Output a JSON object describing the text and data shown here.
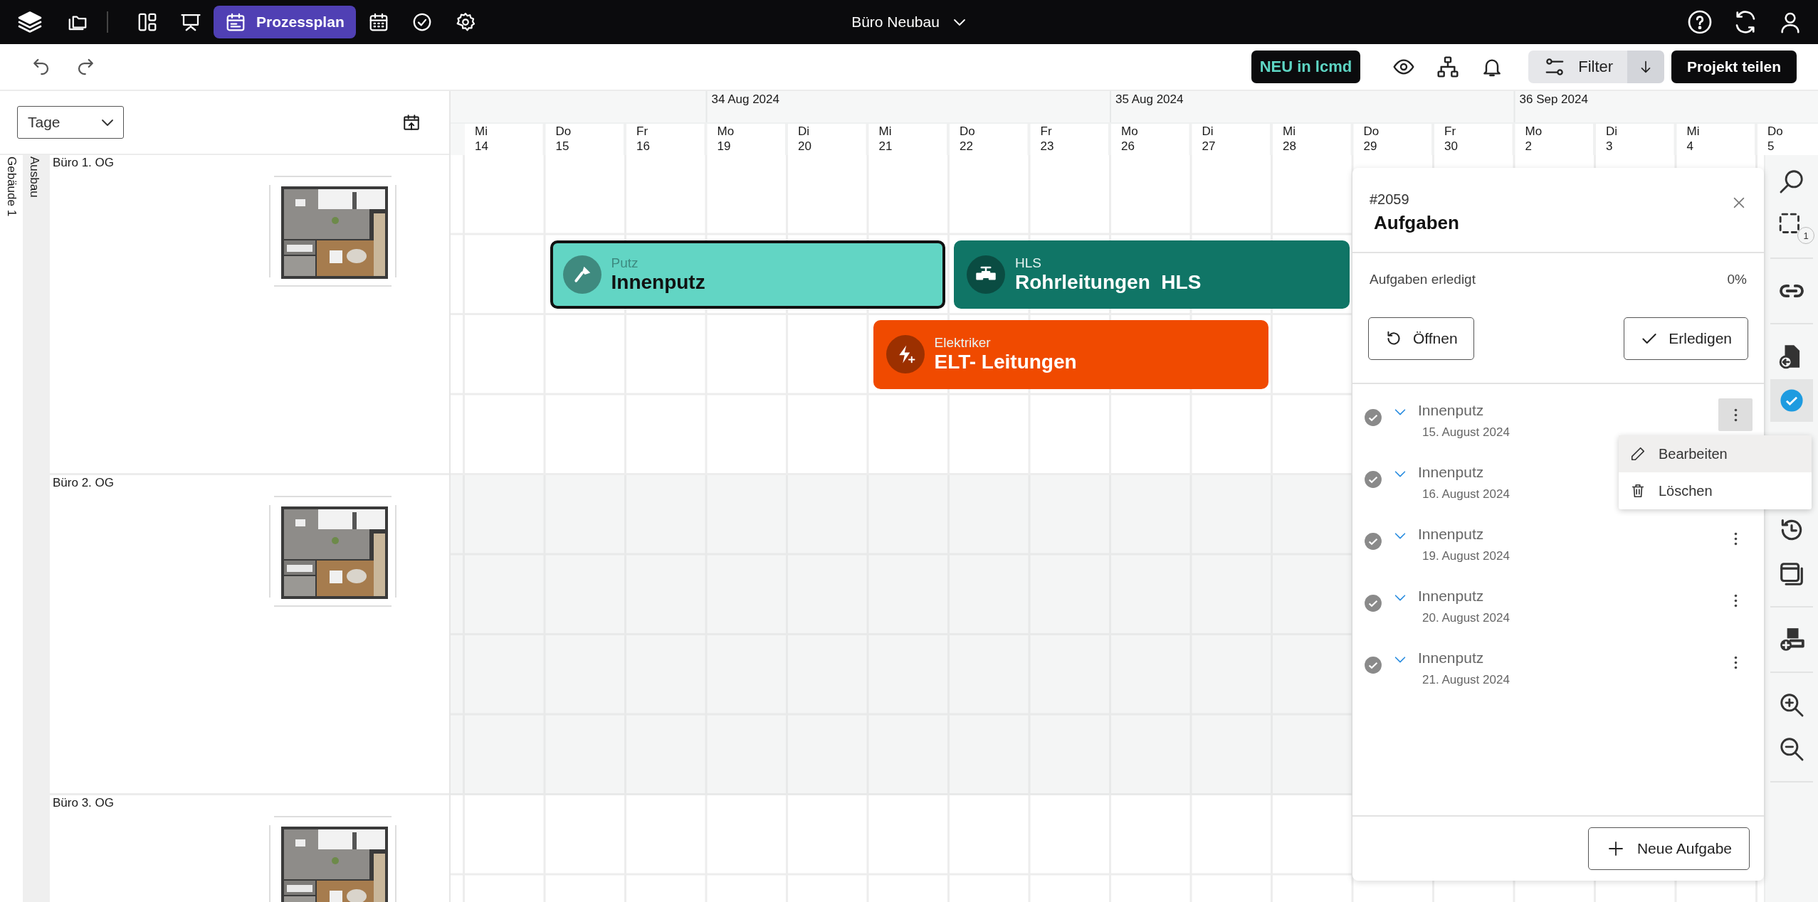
{
  "top_bar": {
    "nav": [
      {
        "kind": "icon",
        "selected": false
      },
      {
        "kind": "icon",
        "selected": false
      },
      {
        "kind": "label",
        "label": "Prozessplan",
        "selected": true
      },
      {
        "kind": "icon",
        "selected": false
      },
      {
        "kind": "icon",
        "selected": false
      },
      {
        "kind": "icon",
        "selected": false
      }
    ],
    "project": "Büro Neubau"
  },
  "toolbar": {
    "news_badge": "NEU in lcmd",
    "filter_button": "Filter",
    "share_button": "Projekt teilen"
  },
  "sidebar": {
    "view_select": {
      "value": "Tage"
    },
    "building": "Gebäude 1",
    "trade_group": "Ausbau",
    "floors": [
      {
        "name": "Büro 1. OG"
      },
      {
        "name": "Büro 2. OG"
      },
      {
        "name": "Büro 3. OG"
      }
    ]
  },
  "timeline": {
    "weeks": [
      "34 Aug 2024",
      "35 Aug 2024",
      "36 Sep 2024"
    ],
    "days": [
      {
        "weekday": "Mi",
        "day": "14"
      },
      {
        "weekday": "Do",
        "day": "15"
      },
      {
        "weekday": "Fr",
        "day": "16"
      },
      {
        "weekday": "Mo",
        "day": "19"
      },
      {
        "weekday": "Di",
        "day": "20"
      },
      {
        "weekday": "Mi",
        "day": "21"
      },
      {
        "weekday": "Do",
        "day": "22"
      },
      {
        "weekday": "Fr",
        "day": "23"
      },
      {
        "weekday": "Mo",
        "day": "26"
      },
      {
        "weekday": "Di",
        "day": "27"
      },
      {
        "weekday": "Mi",
        "day": "28"
      },
      {
        "weekday": "Do",
        "day": "29"
      },
      {
        "weekday": "Fr",
        "day": "30"
      },
      {
        "weekday": "Mo",
        "day": "2"
      },
      {
        "weekday": "Di",
        "day": "3"
      },
      {
        "weekday": "Mi",
        "day": "4"
      },
      {
        "weekday": "Do",
        "day": "5"
      }
    ],
    "tasks": [
      {
        "trade": "Putz",
        "title": "Innenputz",
        "color": "#62d5c4",
        "selected": true
      },
      {
        "trade": "HLS",
        "title": "Rohrleitungen  HLS",
        "color": "#107566",
        "selected": false
      },
      {
        "trade": "Elektriker",
        "title": "ELT- Leitungen",
        "color": "#f04a00",
        "selected": false
      }
    ]
  },
  "task_panel": {
    "number": "#2059",
    "title": "Aufgaben",
    "progress_label": "Aufgaben erledigt",
    "progress_value": "0%",
    "buttons": [
      "Öffnen",
      "Erledigen"
    ],
    "items": [
      {
        "title": "Innenputz",
        "date": "15. August 2024",
        "menu_open": true
      },
      {
        "title": "Innenputz",
        "date": "16. August 2024",
        "menu_open": false
      },
      {
        "title": "Innenputz",
        "date": "19. August 2024",
        "menu_open": false
      },
      {
        "title": "Innenputz",
        "date": "20. August 2024",
        "menu_open": false
      },
      {
        "title": "Innenputz",
        "date": "21. August 2024",
        "menu_open": false
      }
    ],
    "new_button": "Neue Aufgabe"
  },
  "context_menu": [
    {
      "label": "Bearbeiten",
      "highlighted": true
    },
    {
      "label": "Löschen",
      "highlighted": false
    }
  ],
  "tool_rail": {
    "selection_count": "1",
    "items": [
      {
        "selected": false
      },
      {
        "selected": false
      },
      {
        "selected": false
      },
      {
        "selected": false
      },
      {
        "selected": true
      },
      {
        "selected": false
      },
      {
        "selected": false
      },
      {
        "selected": false
      },
      {
        "selected": false
      },
      {
        "selected": false
      }
    ]
  }
}
